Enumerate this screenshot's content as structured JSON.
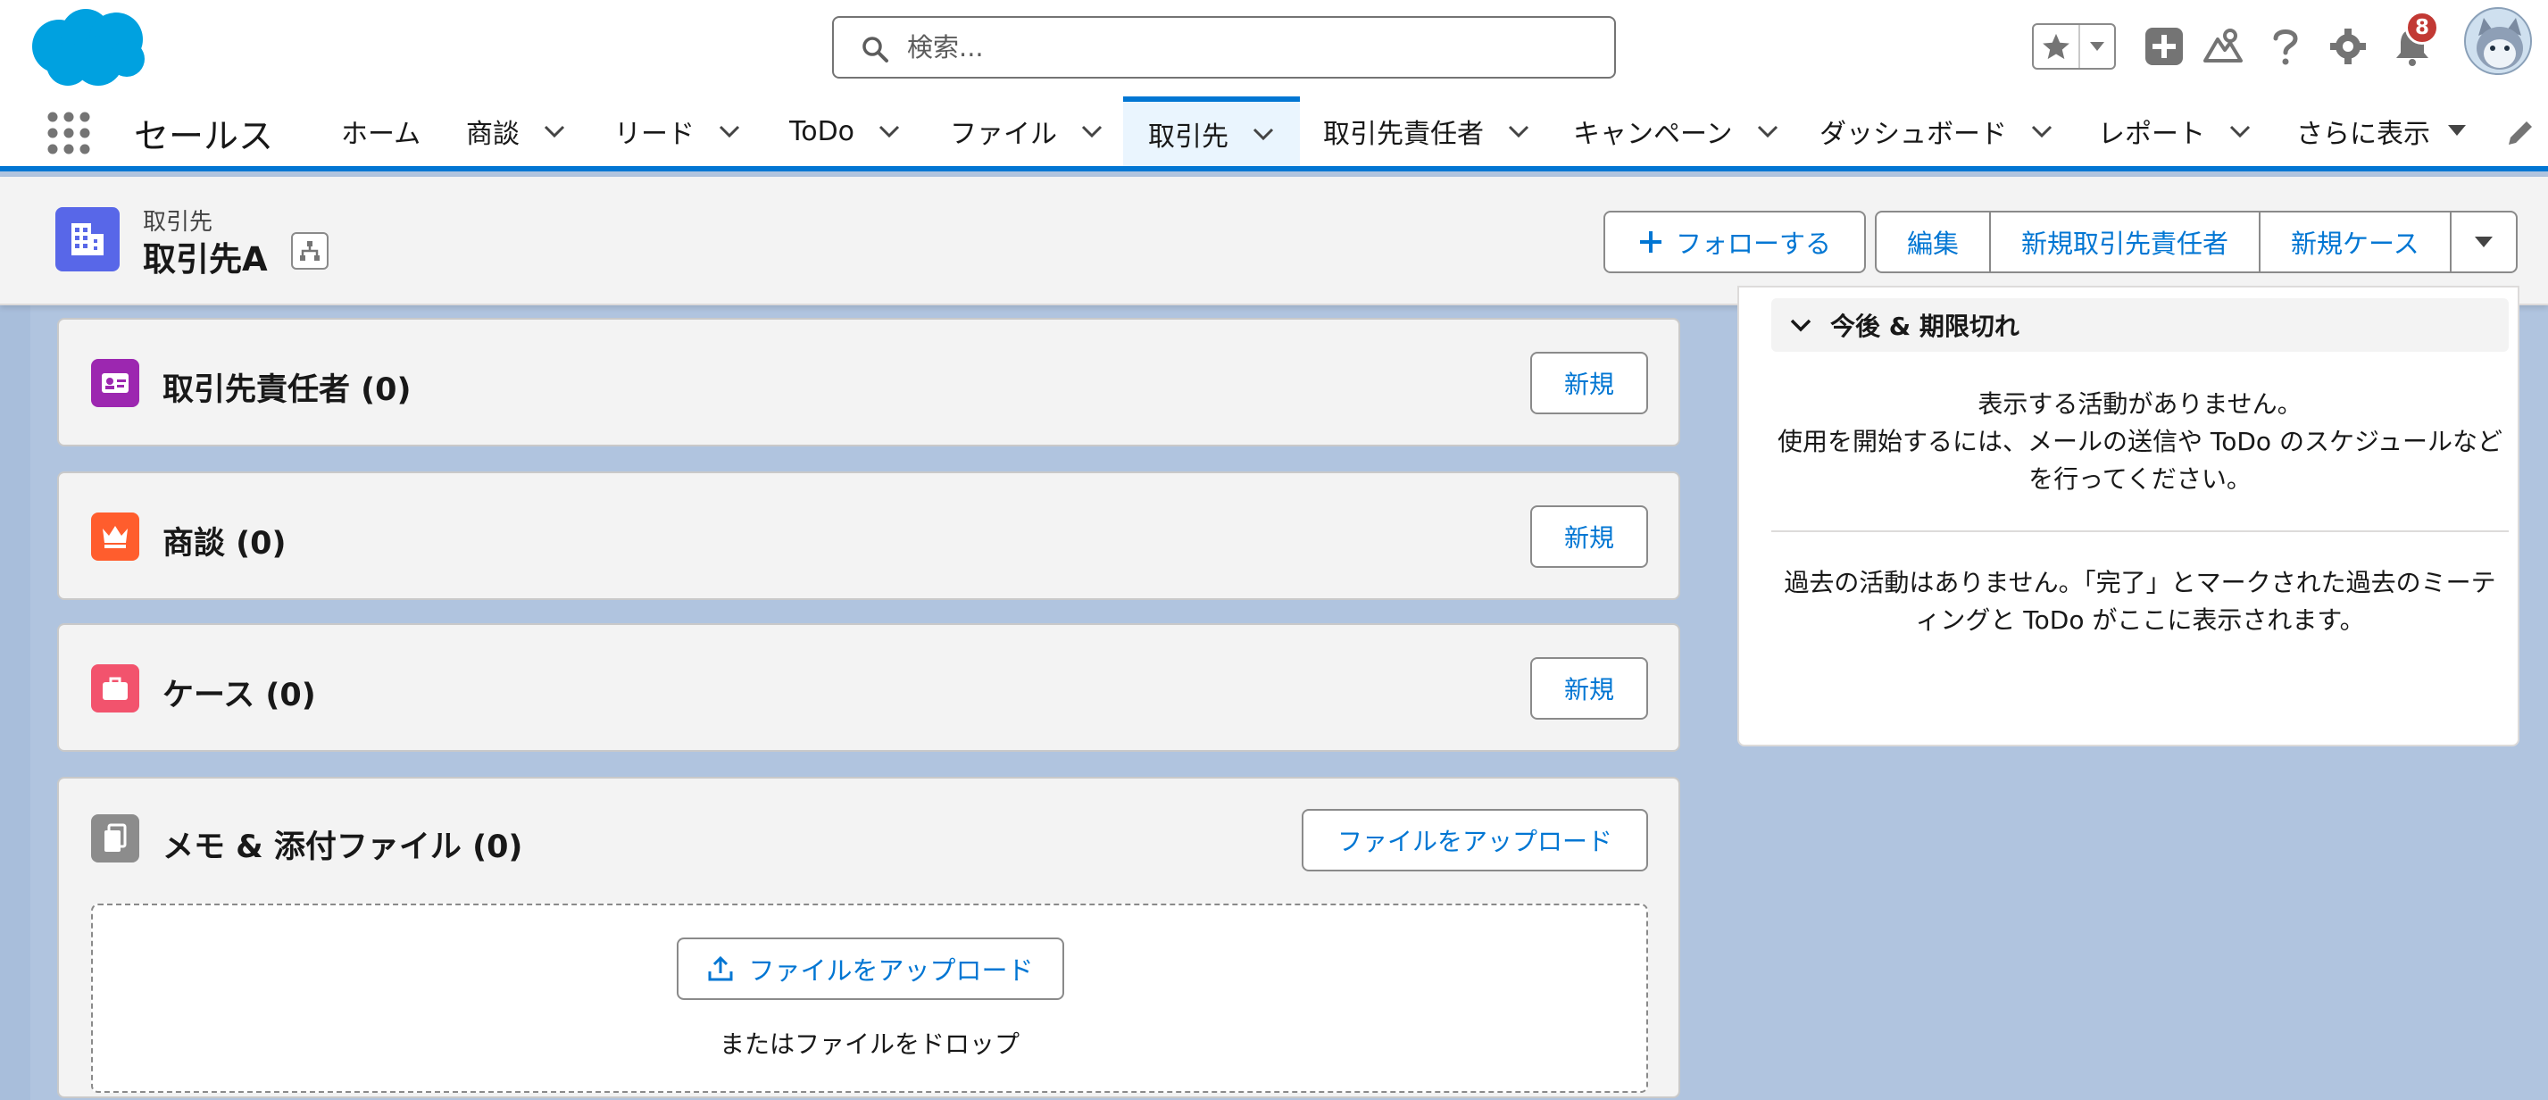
{
  "global_header": {
    "search_placeholder": "検索...",
    "notification_count": "8",
    "icons": [
      "cloud-logo",
      "search-icon",
      "star-icon",
      "chevron-down-icon",
      "add-icon",
      "trailhead-icon",
      "help-icon",
      "gear-icon",
      "bell-icon",
      "avatar"
    ]
  },
  "nav": {
    "app_name": "セールス",
    "items": [
      {
        "label": "ホーム",
        "has_menu": false
      },
      {
        "label": "商談",
        "has_menu": true
      },
      {
        "label": "リード",
        "has_menu": true
      },
      {
        "label": "ToDo",
        "has_menu": true
      },
      {
        "label": "ファイル",
        "has_menu": true
      },
      {
        "label": "取引先",
        "has_menu": true,
        "active": true
      },
      {
        "label": "取引先責任者",
        "has_menu": true
      },
      {
        "label": "キャンペーン",
        "has_menu": true
      },
      {
        "label": "ダッシュボード",
        "has_menu": true
      },
      {
        "label": "レポート",
        "has_menu": true
      }
    ],
    "more_label": "さらに表示"
  },
  "record": {
    "object_type": "取引先",
    "name": "取引先A",
    "follow_label": "フォローする",
    "actions": [
      "編集",
      "新規取引先責任者",
      "新規ケース"
    ]
  },
  "related_lists": [
    {
      "title": "取引先責任者 (0)",
      "button": "新規",
      "icon_color": "#9c27b0"
    },
    {
      "title": "商談 (0)",
      "button": "新規",
      "icon_color": "#ff5d2d"
    },
    {
      "title": "ケース (0)",
      "button": "新規",
      "icon_color": "#f2536d"
    },
    {
      "title": "メモ & 添付ファイル (0)",
      "button": "ファイルをアップロード",
      "icon_color": "#8c8c8c"
    }
  ],
  "file_drop": {
    "upload_label": "ファイルをアップロード",
    "drop_text": "またはファイルをドロップ"
  },
  "activity": {
    "section_label": "今後 & 期限切れ",
    "no_activity_line1": "表示する活動がありません。",
    "no_activity_line2": "使用を開始するには、メールの送信や ToDo のスケジュールなど",
    "no_activity_line3": "を行ってください。",
    "past_line1": "過去の活動はありません。「完了」とマークされた過去のミーテ",
    "past_line2": "ィングと ToDo がここに表示されます。"
  },
  "colors": {
    "brand_blue": "#0176d3",
    "page_background": "#b0c4df",
    "record_icon": "#5867e8",
    "badge_red": "#c23934"
  }
}
